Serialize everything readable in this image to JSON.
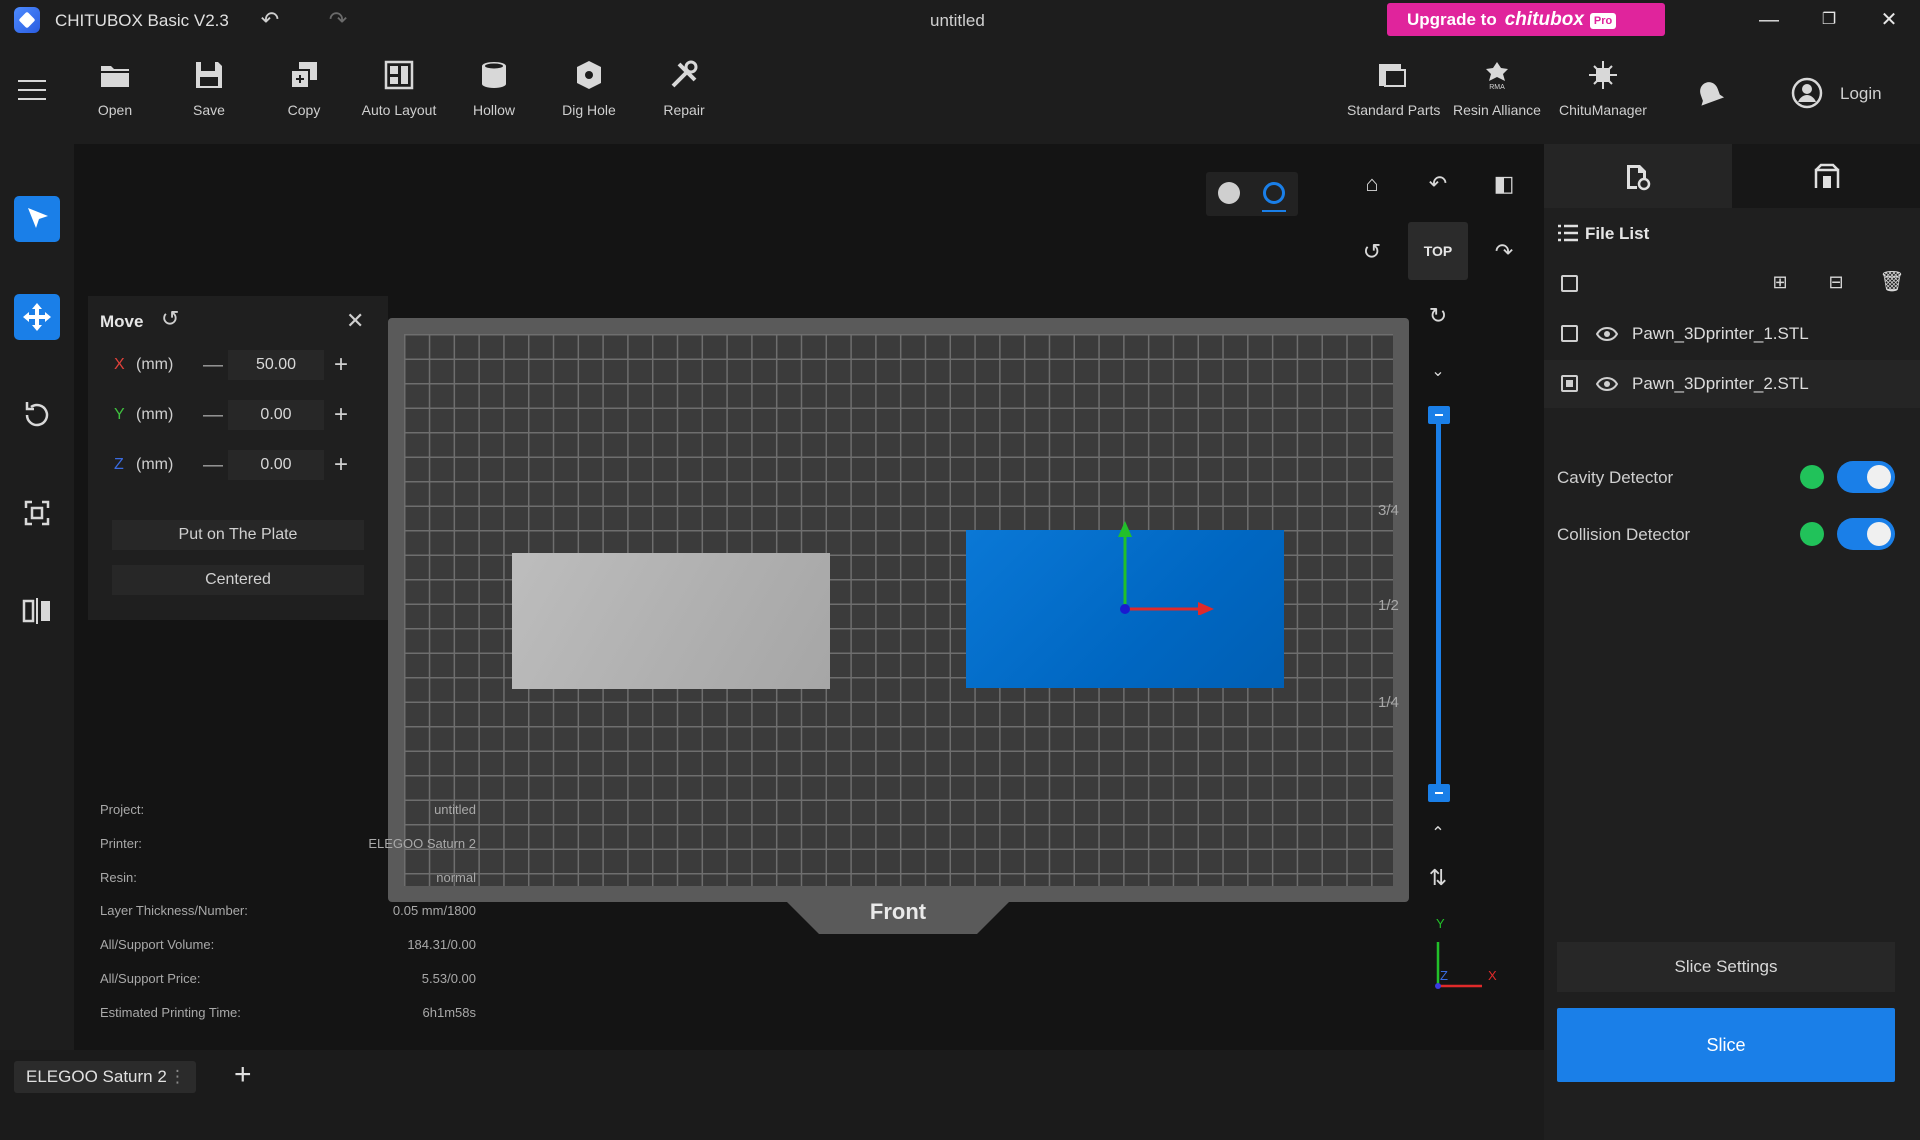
{
  "titlebar": {
    "app_name": "CHITUBOX Basic V2.3",
    "doc_title": "untitled",
    "upgrade_prefix": "Upgrade to",
    "upgrade_brand": "chitubox",
    "upgrade_pro": "Pro",
    "undo_icon": "undo-icon",
    "redo_icon": "redo-icon"
  },
  "toolbar": {
    "open": "Open",
    "save": "Save",
    "copy": "Copy",
    "auto_layout": "Auto Layout",
    "hollow": "Hollow",
    "dig_hole": "Dig Hole",
    "repair": "Repair",
    "standard_parts": "Standard Parts",
    "resin_alliance": "Resin Alliance",
    "chitu_manager": "ChituManager",
    "login": "Login"
  },
  "move_panel": {
    "title": "Move",
    "x_label": "X",
    "y_label": "Y",
    "z_label": "Z",
    "unit": "(mm)",
    "x_value": "50.00",
    "y_value": "0.00",
    "z_value": "0.00",
    "put_on_plate": "Put on The Plate",
    "centered": "Centered"
  },
  "info": {
    "project_label": "Project:",
    "project_value": "untitled",
    "printer_label": "Printer:",
    "printer_value": "ELEGOO Saturn 2",
    "resin_label": "Resin:",
    "resin_value": "normal",
    "layer_label": "Layer Thickness/Number:",
    "layer_value": "0.05 mm/1800",
    "volume_label": "All/Support Volume:",
    "volume_value": "184.31/0.00",
    "price_label": "All/Support Price:",
    "price_value": "5.53/0.00",
    "time_label": "Estimated Printing Time:",
    "time_value": "6h1m58s"
  },
  "viewport": {
    "front_label": "Front",
    "top_button": "TOP",
    "slider_marks": [
      "3/4",
      "1/2",
      "1/4"
    ],
    "axis_x": "X",
    "axis_y": "Y",
    "axis_z": "Z"
  },
  "right_panel": {
    "file_list_title": "File List",
    "files": [
      {
        "name": "Pawn_3Dprinter_1.STL"
      },
      {
        "name": "Pawn_3Dprinter_2.STL"
      }
    ],
    "cavity_detector": "Cavity Detector",
    "collision_detector": "Collision Detector",
    "slice_settings": "Slice Settings",
    "slice": "Slice"
  },
  "bottom": {
    "printer_tab": "ELEGOO Saturn 2",
    "printer_tab_menu": "⋮",
    "add_printer": "+"
  },
  "colors": {
    "accent": "#1a7fe8",
    "selected_model": "#0067c2",
    "upgrade": "#e0249c",
    "detector_ok": "#21c25a"
  }
}
